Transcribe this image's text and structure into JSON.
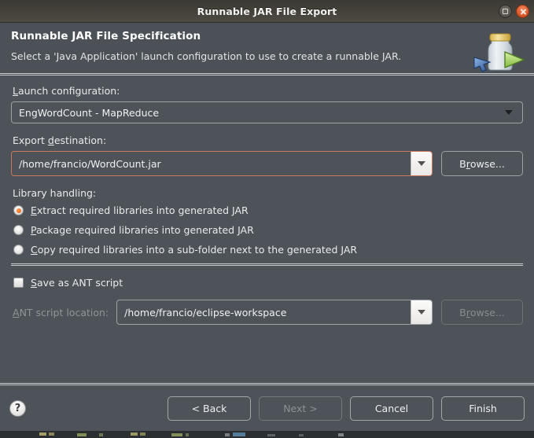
{
  "window": {
    "title": "Runnable JAR File Export",
    "maximize_icon": "maximize-icon",
    "close_icon": "close-icon"
  },
  "header": {
    "title": "Runnable JAR File Specification",
    "description": "Select a 'Java Application' launch configuration to use to create a runnable JAR.",
    "icon": "jar-export-icon"
  },
  "form": {
    "launch_configuration": {
      "label_pre": "",
      "label_mnemonic": "L",
      "label_post": "aunch configuration:",
      "value": "EngWordCount - MapReduce",
      "caret_icon": "chevron-down-icon"
    },
    "export_destination": {
      "label_pre": "Export ",
      "label_mnemonic": "d",
      "label_post": "estination:",
      "value": "/home/francio/WordCount.jar",
      "dropdown_icon": "chevron-down-icon",
      "browse_pre": "B",
      "browse_mnemonic": "r",
      "browse_post": "owse...",
      "browse_label": "Browse..."
    },
    "library_handling": {
      "label": "Library handling:",
      "options": [
        {
          "pre": "",
          "mnemonic": "E",
          "post": "xtract required libraries into generated JAR",
          "label": "Extract required libraries into generated JAR",
          "selected": true
        },
        {
          "pre": "",
          "mnemonic": "P",
          "post": "ackage required libraries into generated JAR",
          "label": "Package required libraries into generated JAR",
          "selected": false
        },
        {
          "pre": "",
          "mnemonic": "C",
          "post": "opy required libraries into a sub-folder next to the generated JAR",
          "label": "Copy required libraries into a sub-folder next to the generated JAR",
          "selected": false
        }
      ]
    },
    "save_ant": {
      "pre": "",
      "mnemonic": "S",
      "post": "ave as ANT script",
      "label": "Save as ANT script",
      "checked": false
    },
    "ant_location": {
      "label_pre": "",
      "label_mnemonic": "A",
      "label_post": "NT script location:",
      "label": "ANT script location:",
      "value": "/home/francio/eclipse-workspace",
      "dropdown_icon": "chevron-down-icon",
      "browse_pre": "B",
      "browse_mnemonic": "r",
      "browse_post": "owse...",
      "browse_label": "Browse...",
      "disabled": true
    }
  },
  "footer": {
    "help_icon": "help-icon",
    "help_glyph": "?",
    "buttons": [
      {
        "label": "< Back",
        "disabled": false
      },
      {
        "label": "Next >",
        "disabled": true
      },
      {
        "label": "Cancel",
        "disabled": false
      },
      {
        "label": "Finish",
        "disabled": false
      }
    ]
  },
  "colors": {
    "dialog_bg": "#4d5358",
    "header_bg": "#4b5156",
    "titlebar_bg": "#413e38",
    "accent_orange": "#ef6c1b",
    "focus_border": "#c8795f",
    "close_red": "#df5f33",
    "text": "#e9ebec",
    "text_disabled": "#8e9498"
  }
}
